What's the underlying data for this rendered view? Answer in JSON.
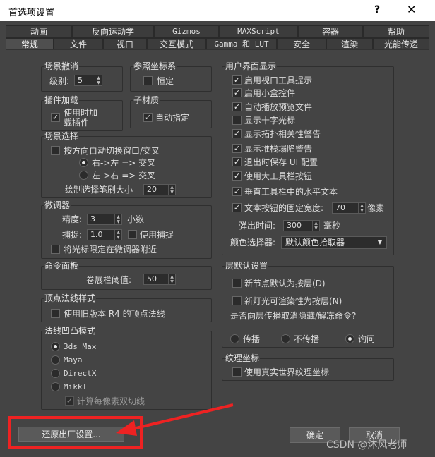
{
  "window": {
    "title": "首选项设置",
    "help": "?",
    "close": "✕"
  },
  "tabs_row1": [
    "动画",
    "反向运动学",
    "Gizmos",
    "MAXScript",
    "容器",
    "帮助"
  ],
  "tabs_row2": [
    "常规",
    "文件",
    "视口",
    "交互模式",
    "Gamma 和 LUT",
    "安全",
    "渲染",
    "光能传递"
  ],
  "scene_undo": {
    "title": "场景撤消",
    "levels_label": "级别:",
    "levels_value": "5"
  },
  "ref_coord": {
    "title": "参照坐标系",
    "constant_label": "恒定"
  },
  "plugin_load": {
    "title": "插件加载",
    "load_on_use_line1": "使用时加",
    "load_on_use_line2": "载插件"
  },
  "sub_material": {
    "title": "子材质",
    "auto_assign_label": "自动指定"
  },
  "scene_select": {
    "title": "场景选择",
    "auto_switch_label": "按方向自动切换窗口/交叉",
    "right_left_label": "右->左 => 交叉",
    "left_right_label": "左->右 => 交叉",
    "brush_size_label": "绘制选择笔刷大小",
    "brush_size_value": "20"
  },
  "spinner": {
    "title": "微调器",
    "precision_label": "精度:",
    "precision_value": "3",
    "decimal_label": "小数",
    "snap_label": "捕捉:",
    "snap_value": "1.0",
    "use_snap_label": "使用捕捉",
    "wrap_cursor_label": "将光标限定在微调器附近"
  },
  "command_panel": {
    "title": "命令面板",
    "rollup_label": "卷展栏阈值:",
    "rollup_value": "50"
  },
  "vertex_normal": {
    "title": "顶点法线样式",
    "legacy_label": "使用旧版本 R4 的顶点法线"
  },
  "normal_bump": {
    "title": "法线凹凸模式",
    "options": [
      "3ds Max",
      "Maya",
      "DirectX",
      "MikkT"
    ],
    "bitangent_label": "计算每像素双切线"
  },
  "ui_display": {
    "title": "用户界面显示",
    "options": [
      "启用视口工具提示",
      "启用小盒控件",
      "自动播放预览文件",
      "显示十字光标",
      "显示拓扑相关性警告",
      "显示堆栈塌陷警告",
      "退出时保存 UI 配置",
      "使用大工具栏按钮",
      "垂直工具栏中的水平文本"
    ],
    "fixed_width_label": "文本按钮的固定宽度:",
    "fixed_width_value": "70",
    "pixels_label": "像素",
    "flyout_label": "弹出时间:",
    "flyout_value": "300",
    "ms_label": "毫秒",
    "color_picker_label": "颜色选择器:",
    "color_picker_value": "默认颜色拾取器"
  },
  "layer_defaults": {
    "title": "层默认设置",
    "new_nodes_label": "新节点默认为按层(D)",
    "new_lights_label": "新灯光可渲染性为按层(N)",
    "propagate_question": "是否向层传播取消隐藏/解冻命令?",
    "propagate_label": "传播",
    "no_propagate_label": "不传播",
    "ask_label": "询问"
  },
  "texture_coords": {
    "title": "纹理坐标",
    "real_world_label": "使用真实世界纹理坐标"
  },
  "buttons": {
    "reset": "还原出厂设置...",
    "ok": "确定",
    "cancel": "取消"
  },
  "watermark": "CSDN @沐风老师"
}
